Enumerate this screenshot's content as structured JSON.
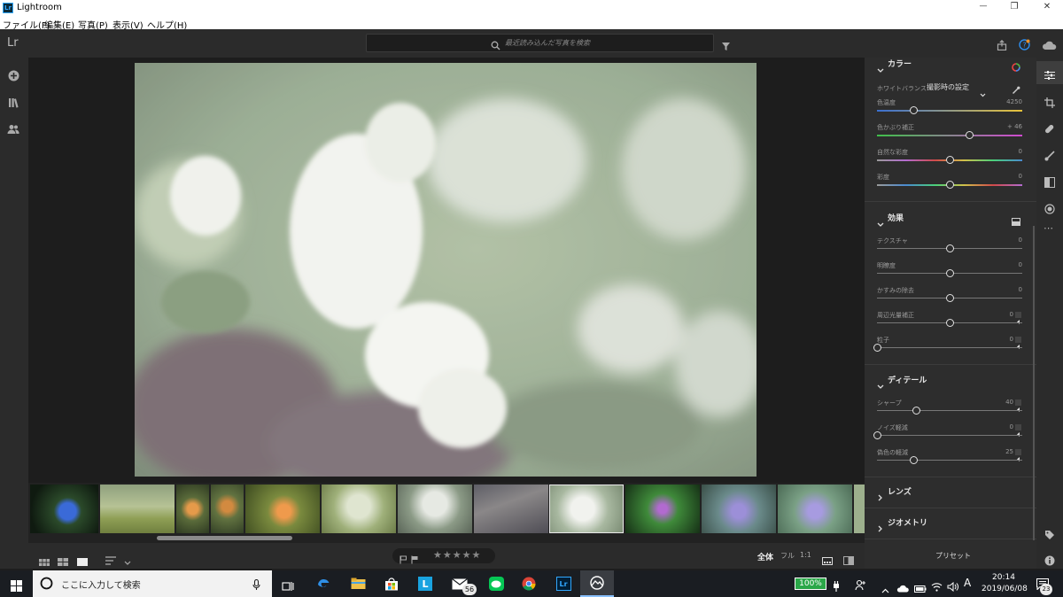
{
  "window": {
    "title": "Lightroom",
    "app_badge": "Lr",
    "controls": {
      "minimize": "—",
      "maximize": "❐",
      "close": "✕"
    }
  },
  "menu": [
    {
      "label": "ファイル(F)"
    },
    {
      "label": "編集(E)"
    },
    {
      "label": "写真(P)"
    },
    {
      "label": "表示(V)"
    },
    {
      "label": "ヘルプ(H)"
    }
  ],
  "header": {
    "logo": "Lr",
    "search_placeholder": "最近読み込んだ写真を検索"
  },
  "panel": {
    "color": {
      "title": "カラー",
      "white_balance_label": "ホワイトバランス",
      "white_balance_value": "撮影時の設定",
      "sliders": [
        {
          "label": "色温度",
          "value": "4250",
          "pos": 0.25
        },
        {
          "label": "色かぶり補正",
          "value": "+ 46",
          "pos": 0.64
        },
        {
          "label": "自然な彩度",
          "value": "0",
          "pos": 0.5
        },
        {
          "label": "彩度",
          "value": "0",
          "pos": 0.5
        }
      ]
    },
    "effects": {
      "title": "効果",
      "sliders": [
        {
          "label": "テクスチャ",
          "value": "0",
          "pos": 0.5
        },
        {
          "label": "明瞭度",
          "value": "0",
          "pos": 0.5
        },
        {
          "label": "かすみの除去",
          "value": "0",
          "pos": 0.5
        },
        {
          "label": "周辺光量補正",
          "value": "0",
          "pos": 0.5
        },
        {
          "label": "粒子",
          "value": "0",
          "pos": 0.0
        }
      ]
    },
    "detail": {
      "title": "ディテール",
      "sliders": [
        {
          "label": "シャープ",
          "value": "40",
          "pos": 0.27
        },
        {
          "label": "ノイズ軽減",
          "value": "0",
          "pos": 0.0
        },
        {
          "label": "偽色の軽減",
          "value": "25",
          "pos": 0.25
        }
      ]
    },
    "lens_title": "レンズ",
    "geometry_title": "ジオメトリ",
    "presets_label": "プリセット"
  },
  "bottom": {
    "zoom_options": [
      "全体",
      "フル",
      "1:1"
    ],
    "stars": "★★★★★"
  },
  "taskbar": {
    "search_placeholder": "ここに入力して検索",
    "mail_badge": "56",
    "battery": "100%",
    "ime": "A",
    "time": "20:14",
    "date": "2019/06/08",
    "notifications": "23"
  }
}
